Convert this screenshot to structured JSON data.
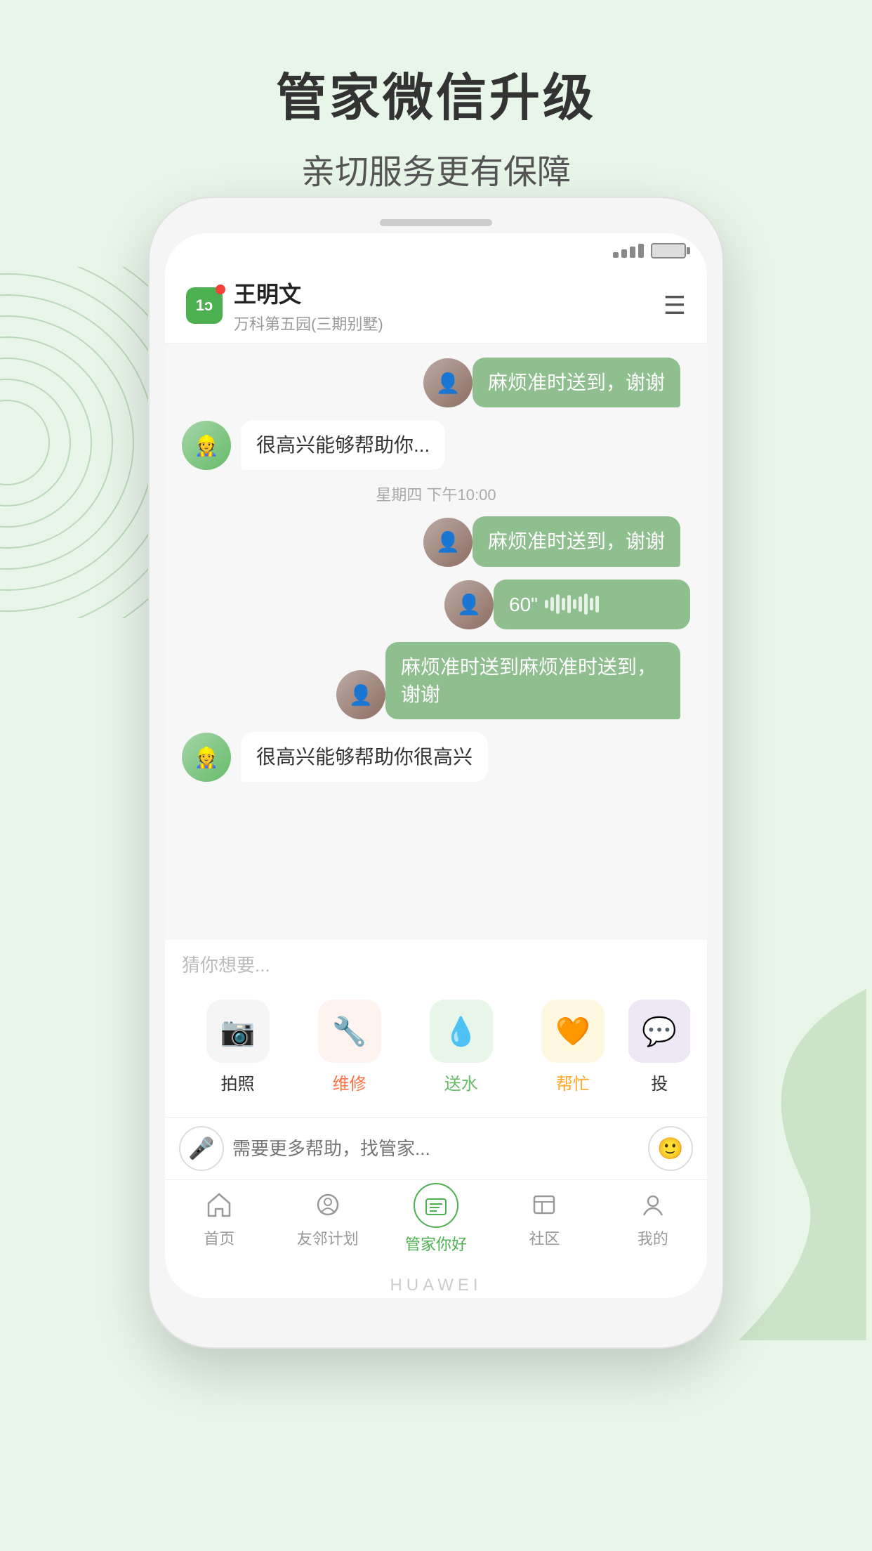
{
  "page": {
    "background_color": "#dcefd7"
  },
  "header": {
    "main_title": "管家微信升级",
    "sub_title": "亲切服务更有保障"
  },
  "phone": {
    "status": {
      "battery": "●●●"
    },
    "chat_header": {
      "logo_text": "1",
      "contact_name": "王明文",
      "contact_sub": "万科第五园(三期别墅)",
      "menu_label": "menu"
    },
    "messages": [
      {
        "id": 1,
        "type": "sent",
        "text": "麻烦准时送到，谢谢"
      },
      {
        "id": 2,
        "type": "received",
        "text": "很高兴能够帮助你..."
      },
      {
        "id": 3,
        "type": "time",
        "text": "星期四 下午10:00"
      },
      {
        "id": 4,
        "type": "sent",
        "text": "麻烦准时送到，谢谢"
      },
      {
        "id": 5,
        "type": "voice_sent",
        "text": "60\""
      },
      {
        "id": 6,
        "type": "sent",
        "text": "麻烦准时送到麻烦准时送到，谢谢"
      },
      {
        "id": 7,
        "type": "received",
        "text": "很高兴能够帮助你很高兴"
      }
    ],
    "quick_panel": {
      "hint": "猜你想要...",
      "actions": [
        {
          "id": 1,
          "label": "拍照",
          "icon": "📷",
          "color": "normal"
        },
        {
          "id": 2,
          "label": "维修",
          "icon": "🔧",
          "color": "orange"
        },
        {
          "id": 3,
          "label": "送水",
          "icon": "💧",
          "color": "green"
        },
        {
          "id": 4,
          "label": "帮忙",
          "icon": "🧡",
          "color": "yellow"
        },
        {
          "id": 5,
          "label": "投诉",
          "icon": "💬",
          "color": "normal"
        }
      ]
    },
    "input_bar": {
      "placeholder": "需要更多帮助，找管家..."
    },
    "bottom_nav": [
      {
        "id": 1,
        "label": "首页",
        "icon": "home",
        "active": false
      },
      {
        "id": 2,
        "label": "友邻计划",
        "icon": "neighborhood",
        "active": false
      },
      {
        "id": 3,
        "label": "管家你好",
        "icon": "butler",
        "active": true
      },
      {
        "id": 4,
        "label": "社区",
        "icon": "community",
        "active": false
      },
      {
        "id": 5,
        "label": "我的",
        "icon": "profile",
        "active": false
      }
    ],
    "brand": "HUAWEI"
  }
}
